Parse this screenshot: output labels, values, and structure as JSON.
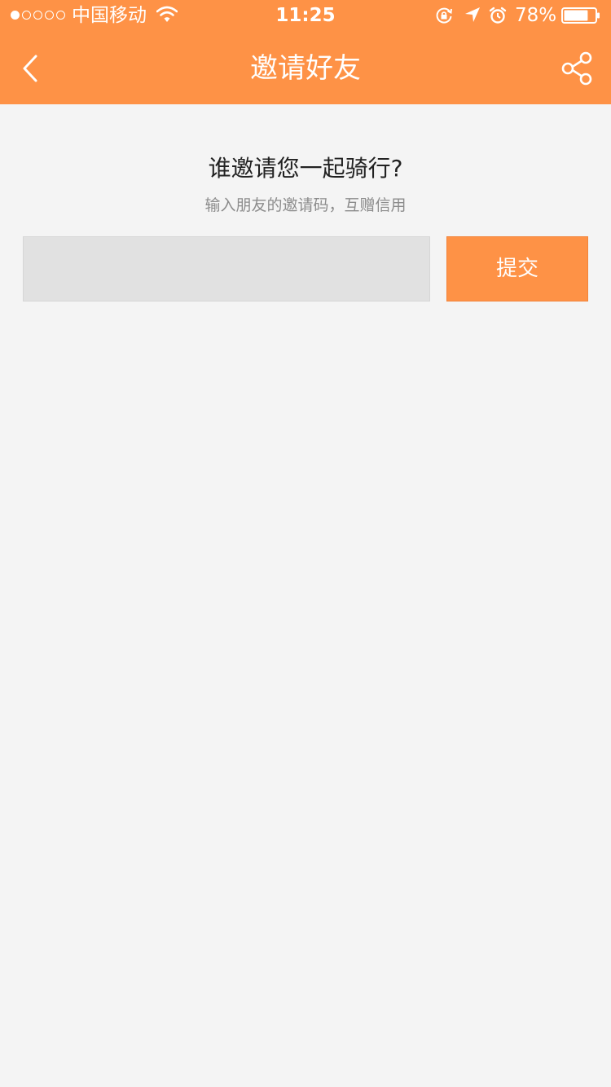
{
  "status_bar": {
    "signal_dots_filled": 1,
    "signal_dots_total": 5,
    "carrier": "中国移动",
    "time": "11:25",
    "battery_percent": "78%",
    "battery_level": 0.78,
    "icons": [
      "wifi-icon",
      "rotation-lock-icon",
      "location-arrow-icon",
      "alarm-clock-icon",
      "battery-icon"
    ]
  },
  "nav": {
    "title": "邀请好友",
    "back_icon": "chevron-left-icon",
    "share_icon": "share-icon"
  },
  "main": {
    "heading": "谁邀请您一起骑行?",
    "subheading": "输入朋友的邀请码，互赠信用",
    "code_input": {
      "value": "",
      "placeholder": ""
    },
    "submit_label": "提交"
  },
  "colors": {
    "accent": "#fe9246",
    "background": "#f4f4f4",
    "input_background": "#e1e1e1",
    "heading_text": "#222222",
    "subheading_text": "#8c8c8c"
  }
}
